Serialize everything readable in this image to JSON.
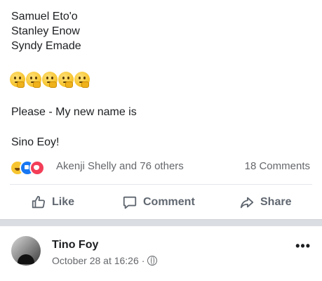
{
  "post": {
    "tagged_names": [
      "Samuel Eto'o",
      "Stanley Enow",
      "Syndy Emade"
    ],
    "emoji_count": 5,
    "emoji_name": "thinking-face",
    "line1": "Please - My new name is",
    "line2": "Sino Eoy!",
    "reactions": {
      "icons": [
        "haha",
        "like",
        "love"
      ],
      "text": "Akenji Shelly and 76 others",
      "comments": "18 Comments"
    },
    "actions": {
      "like": "Like",
      "comment": "Comment",
      "share": "Share"
    }
  },
  "next_post": {
    "author": "Tino Foy",
    "time": "October 28 at 16:26",
    "separator": "·",
    "privacy_icon": "globe-icon",
    "more": "•••"
  },
  "colors": {
    "text": "#1c1e21",
    "muted": "#65676b",
    "like_blue": "#1877f2",
    "love_red": "#f33e58",
    "haha_yellow": "#f7c531",
    "separator": "#dadde1"
  }
}
